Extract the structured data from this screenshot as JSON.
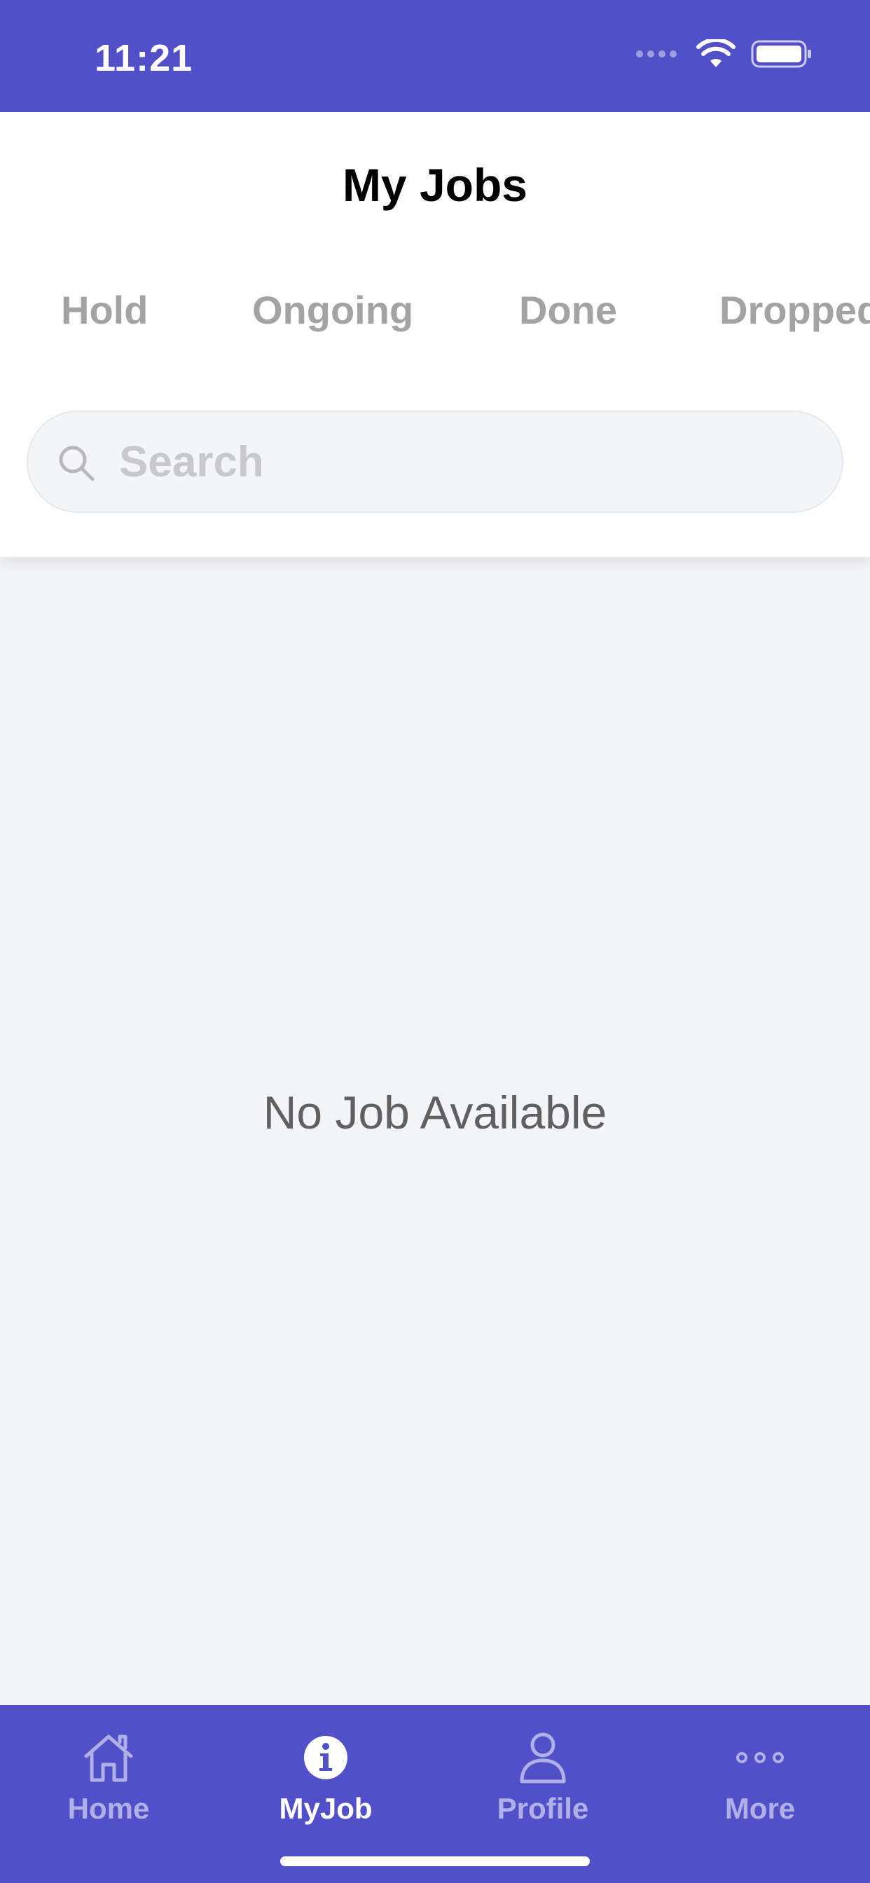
{
  "status_bar": {
    "time": "11:21"
  },
  "header": {
    "title": "My Jobs"
  },
  "tabs": [
    {
      "label": "Hold"
    },
    {
      "label": "Ongoing"
    },
    {
      "label": "Done"
    },
    {
      "label": "Dropped"
    }
  ],
  "search": {
    "placeholder": "Search",
    "value": ""
  },
  "empty_state": {
    "message": "No Job Available"
  },
  "bottom_nav": {
    "items": [
      {
        "label": "Home",
        "icon": "home-icon"
      },
      {
        "label": "MyJob",
        "icon": "info-icon",
        "active": true
      },
      {
        "label": "Profile",
        "icon": "person-icon"
      },
      {
        "label": "More",
        "icon": "more-dots-icon"
      }
    ]
  },
  "colors": {
    "brand": "#5150C9",
    "background": "#F3F4F8",
    "tab_inactive": "#A3A3A3",
    "empty_text": "#606060"
  }
}
